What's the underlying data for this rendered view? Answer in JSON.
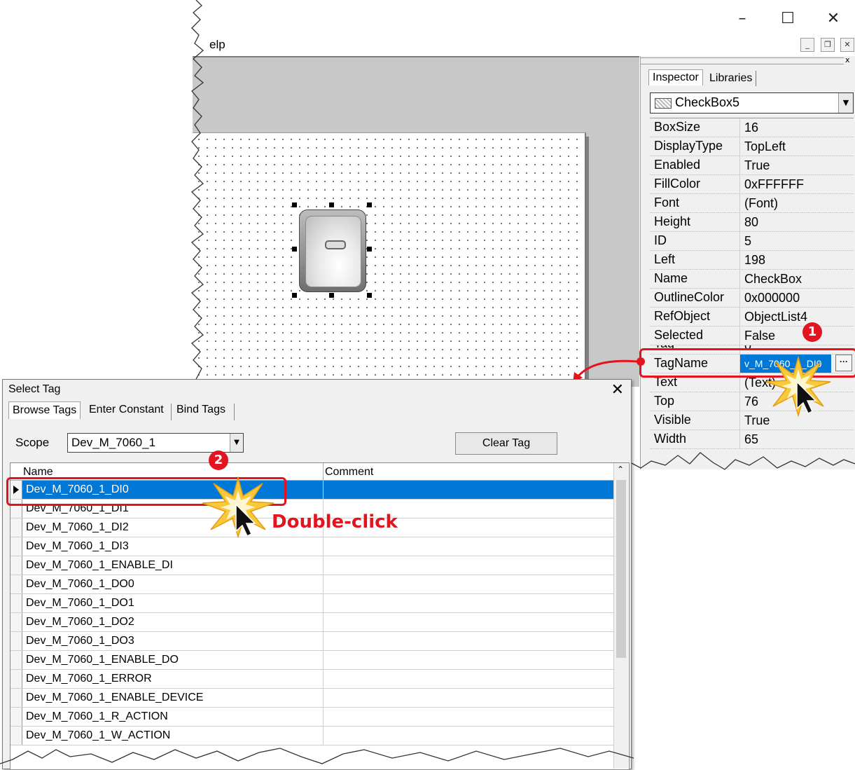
{
  "window": {
    "minimize_icon": "minimize-icon",
    "maximize_icon": "maximize-icon",
    "close_icon": "close-icon",
    "menu_help": "elp"
  },
  "inspector": {
    "tabs": [
      "Inspector",
      "Libraries"
    ],
    "selected_object": "CheckBox5",
    "properties": [
      {
        "name": "BoxSize",
        "value": "16"
      },
      {
        "name": "DisplayType",
        "value": "TopLeft"
      },
      {
        "name": "Enabled",
        "value": "True"
      },
      {
        "name": "FillColor",
        "value": "0xFFFFFF"
      },
      {
        "name": "Font",
        "value": "(Font)"
      },
      {
        "name": "Height",
        "value": "80"
      },
      {
        "name": "ID",
        "value": "5"
      },
      {
        "name": "Left",
        "value": "198"
      },
      {
        "name": "Name",
        "value": "CheckBox"
      },
      {
        "name": "OutlineColor",
        "value": "0x000000"
      },
      {
        "name": "RefObject",
        "value": "ObjectList4"
      },
      {
        "name": "Selected",
        "value": "False"
      },
      {
        "name": "Tag",
        "value": "0"
      },
      {
        "name": "TagName",
        "value": "v_M_7060_1_DI0"
      },
      {
        "name": "Text",
        "value": "(Text)"
      },
      {
        "name": "Top",
        "value": "76"
      },
      {
        "name": "Visible",
        "value": "True"
      },
      {
        "name": "Width",
        "value": "65"
      }
    ],
    "ellipsis_label": "···"
  },
  "dialog": {
    "title": "Select Tag",
    "tabs": [
      "Browse Tags",
      "Enter Constant",
      "Bind Tags"
    ],
    "scope_label": "Scope",
    "scope_value": "Dev_M_7060_1",
    "clear_button": "Clear Tag",
    "columns": [
      "Name",
      "Comment"
    ],
    "rows": [
      "Dev_M_7060_1_DI0",
      "Dev_M_7060_1_DI1",
      "Dev_M_7060_1_DI2",
      "Dev_M_7060_1_DI3",
      "Dev_M_7060_1_ENABLE_DI",
      "Dev_M_7060_1_DO0",
      "Dev_M_7060_1_DO1",
      "Dev_M_7060_1_DO2",
      "Dev_M_7060_1_DO3",
      "Dev_M_7060_1_ENABLE_DO",
      "Dev_M_7060_1_ERROR",
      "Dev_M_7060_1_ENABLE_DEVICE",
      "Dev_M_7060_1_R_ACTION",
      "Dev_M_7060_1_W_ACTION"
    ]
  },
  "annotations": {
    "step1": "1",
    "step2": "2",
    "double_click": "Double-click",
    "accent_color": "#e2141f",
    "selection_color": "#0078d7"
  }
}
